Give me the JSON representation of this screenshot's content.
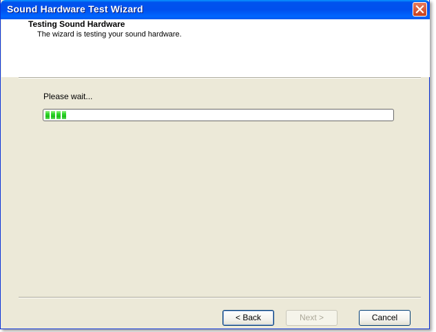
{
  "window": {
    "title": "Sound Hardware Test Wizard"
  },
  "header": {
    "title": "Testing Sound Hardware",
    "subtitle": "The wizard is testing your sound hardware."
  },
  "body": {
    "status_text": "Please wait...",
    "progress": {
      "chunks_filled": 4,
      "color": "#2fd82a"
    }
  },
  "buttons": {
    "back": "< Back",
    "next": "Next >",
    "cancel": "Cancel"
  },
  "icons": {
    "close": "close-icon"
  },
  "colors": {
    "titlebar": "#0050ee",
    "face": "#ece9d8"
  }
}
